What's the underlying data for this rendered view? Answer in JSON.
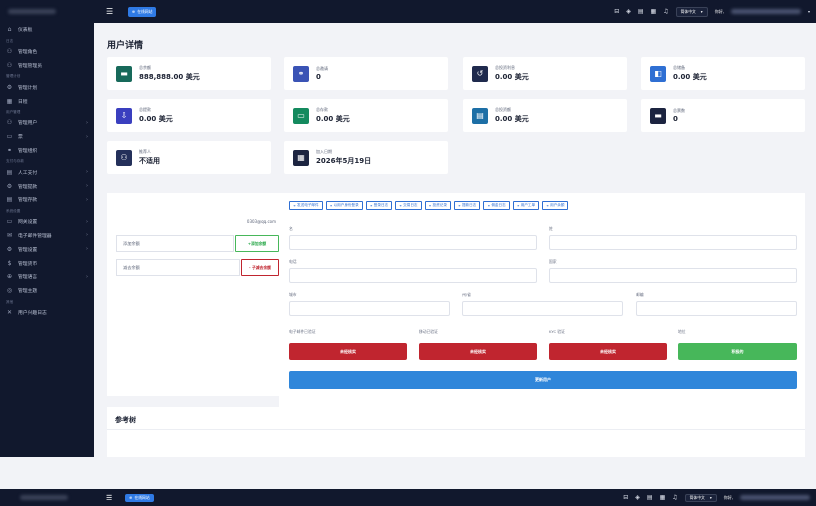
{
  "topbar": {
    "online_label": "在线网站",
    "language": "简体中文",
    "user_prefix": "你好,"
  },
  "sidebar": {
    "items": [
      {
        "type": "item",
        "icon": "⌂",
        "icon_name": "home-icon",
        "label": "仪表板"
      },
      {
        "type": "section",
        "label": "日志"
      },
      {
        "type": "item",
        "icon": "⚇",
        "icon_name": "users-icon",
        "label": "管理角色"
      },
      {
        "type": "item",
        "icon": "⚇",
        "icon_name": "user-admin-icon",
        "label": "管理管理员"
      },
      {
        "type": "section",
        "label": "管理计划"
      },
      {
        "type": "item",
        "icon": "⚙",
        "icon_name": "gear-icon",
        "label": "管理计划"
      },
      {
        "type": "item",
        "icon": "▦",
        "icon_name": "calendar-icon",
        "label": "日程"
      },
      {
        "type": "section",
        "label": "用户管理"
      },
      {
        "type": "item",
        "icon": "⚇",
        "icon_name": "user-icon",
        "label": "管理用户",
        "chevron": true
      },
      {
        "type": "item",
        "icon": "▭",
        "icon_name": "inbox-icon",
        "label": "票",
        "chevron": true
      },
      {
        "type": "item",
        "icon": "⚭",
        "icon_name": "link-icon",
        "label": "管理组织"
      },
      {
        "type": "section",
        "label": "支付与存款"
      },
      {
        "type": "item",
        "icon": "▤",
        "icon_name": "manual-pay-icon",
        "label": "人工支付",
        "chevron": true
      },
      {
        "type": "item",
        "icon": "⚙",
        "icon_name": "withdraw-icon",
        "label": "管理提款",
        "chevron": true
      },
      {
        "type": "item",
        "icon": "▤",
        "icon_name": "deposit-icon",
        "label": "管理存款",
        "chevron": true
      },
      {
        "type": "section",
        "label": "系统设置"
      },
      {
        "type": "item",
        "icon": "▭",
        "icon_name": "gateway-icon",
        "label": "网关设置",
        "chevron": true
      },
      {
        "type": "item",
        "icon": "✉",
        "icon_name": "mail-icon",
        "label": "电子邮件管理器",
        "chevron": true
      },
      {
        "type": "item",
        "icon": "⚙",
        "icon_name": "settings-icon",
        "label": "管理设置",
        "chevron": true
      },
      {
        "type": "item",
        "icon": "$",
        "icon_name": "currency-icon",
        "label": "管理货币"
      },
      {
        "type": "item",
        "icon": "⊕",
        "icon_name": "globe-icon",
        "label": "管理语言",
        "chevron": true
      },
      {
        "type": "item",
        "icon": "◎",
        "icon_name": "theme-icon",
        "label": "管理主题"
      },
      {
        "type": "section",
        "label": "其他"
      },
      {
        "type": "item",
        "icon": "✕",
        "icon_name": "log-icon",
        "label": "用户兴趣日志"
      }
    ]
  },
  "page": {
    "title": "用户详情"
  },
  "cards": [
    {
      "icon": "▬",
      "icon_name": "wallet-icon",
      "color": "#17695a",
      "label": "总余额",
      "value": "888,888.00 美元"
    },
    {
      "icon": "⚭",
      "icon_name": "link-icon",
      "color": "#3a53b5",
      "label": "总邀请",
      "value": "0"
    },
    {
      "icon": "↺",
      "icon_name": "refresh-icon",
      "color": "#1f2a4d",
      "label": "总投资利息",
      "value": "0.00 美元"
    },
    {
      "icon": "◧",
      "icon_name": "stack-icon",
      "color": "#2f6fd3",
      "label": "总储备",
      "value": "0.00 美元"
    },
    {
      "icon": "⇩",
      "icon_name": "deposit-card-icon",
      "color": "#3a3fbf",
      "label": "总提款",
      "value": "0.00 美元"
    },
    {
      "icon": "▭",
      "icon_name": "card-icon",
      "color": "#148a5e",
      "label": "总存款",
      "value": "0.00 美元"
    },
    {
      "icon": "▤",
      "icon_name": "coins-icon",
      "color": "#1d6fa6",
      "label": "总投资额",
      "value": "0.00 美元"
    },
    {
      "icon": "▬",
      "icon_name": "ticket-icon",
      "color": "#1c2440",
      "label": "总票数",
      "value": "0"
    },
    {
      "icon": "⚇",
      "icon_name": "referrer-icon",
      "color": "#24305a",
      "label": "推荐人",
      "value": "不适用"
    },
    {
      "icon": "▦",
      "icon_name": "calendar-icon",
      "color": "#1c2440",
      "label": "加入日期",
      "value": "2026年5月19日"
    }
  ],
  "left_panel": {
    "email": "0303@qq.com",
    "add_balance_placeholder": "添加余额",
    "add_balance_button": "+添加余额",
    "sub_balance_placeholder": "减去余额",
    "sub_balance_button": "- 子减去余额"
  },
  "tabs": [
    "发送电子邮件",
    "以用户身份登录",
    "登录日志",
    "交易日志",
    "投资记录",
    "提款日志",
    "佣金日志",
    "用户工单",
    "用户余额"
  ],
  "form": {
    "first_name": "名",
    "last_name": "姓",
    "phone": "电话",
    "country": "国家",
    "city": "城市",
    "state": "州/省",
    "zip": "邮编",
    "email_verified": "电子邮件已验证",
    "phone_verified": "移动已验证",
    "kyc_verified": "KYC 验证",
    "status": "地位",
    "email_verified_value": "未经核实",
    "phone_verified_value": "未经核实",
    "kyc_verified_value": "未经核实",
    "status_value": "积极的",
    "update_button": "更新用户"
  },
  "ref_tree": {
    "title": "参考树"
  },
  "colors": {
    "sidebar_bg": "#11182d",
    "primary": "#2f6fd3",
    "danger": "#c0252f",
    "success": "#47b75a"
  }
}
